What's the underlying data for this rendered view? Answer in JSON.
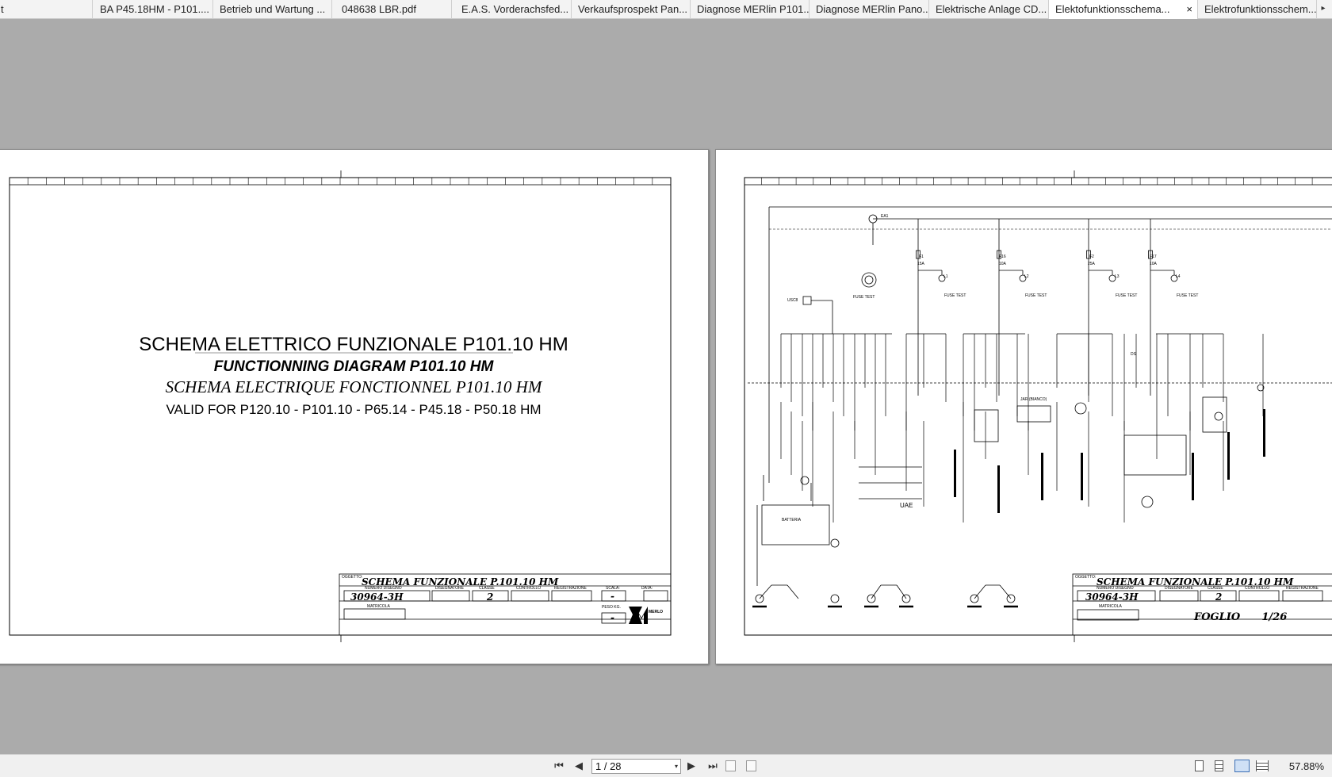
{
  "tabs": [
    {
      "label": "t"
    },
    {
      "label": "BA P45.18HM - P101...."
    },
    {
      "label": "Betrieb und Wartung ..."
    },
    {
      "label": "048638 LBR.pdf"
    },
    {
      "label": "E.A.S. Vorderachsfed..."
    },
    {
      "label": "Verkaufsprospekt Pan..."
    },
    {
      "label": "Diagnose MERlin P101..."
    },
    {
      "label": "Diagnose MERlin Pano..."
    },
    {
      "label": "Elektrische Anlage CD..."
    },
    {
      "label": "Elektofunktionsschema..."
    },
    {
      "label": "Elektrofunktionsschem..."
    }
  ],
  "tab_close": "×",
  "tab_scroll": "▸",
  "page1": {
    "title_it": "SCHEMA ELETTRICO FUNZIONALE P101.10 HM",
    "title_en": "FUNCTIONNING DIAGRAM P101.10 HM",
    "title_fr": "SCHEMA ELECTRIQUE FONCTIONNEL  P101.10 HM",
    "valid": "VALID FOR P120.10 - P101.10 - P65.14 - P45.18 - P50.18 HM",
    "tb": {
      "oggetto_label": "OGGETTO:",
      "oggetto": "SCHEMA  FUNZIONALE  P.101.10  HM",
      "numero_label": "NUMERO DISEGNO",
      "numero": "30964-3H",
      "disegnatore_label": "DISEGNATORE",
      "classe_label": "CLASSE",
      "classe": "2",
      "controllo_label": "CONTROLLO",
      "registrazione_label": "REGISTRAZIONE",
      "scala_label": "SCALA:",
      "scala": "-",
      "data_label": "DATA:",
      "matricola_label": "MATRICOLA",
      "peso_label": "PESO KG.",
      "peso": "-",
      "logo": "MERLO"
    }
  },
  "page2": {
    "labels": {
      "ea1": "EA1",
      "fuse_test_main": "FUSE TEST",
      "usc8": "USC8",
      "f1": "F1",
      "f1a": "15A",
      "f16": "F16",
      "f16a": "10A",
      "f2": "F2",
      "f2a": "25A",
      "f17": "F17",
      "f17a": "10A",
      "l1": "L1",
      "l2": "L2",
      "l3": "L3",
      "l4": "L4",
      "ft": "FUSE TEST",
      "ds": "DS",
      "d": "D",
      "uae": "UAE",
      "batteria": "BATTERIA",
      "jar": "JAR (BIANCO)"
    },
    "tb": {
      "oggetto_label": "OGGETTO:",
      "oggetto": "SCHEMA  FUNZIONALE  P.101.10  HM",
      "numero_label": "NUMERO DISEGNO",
      "numero": "30964-3H",
      "disegnatore_label": "DISEGNATORE",
      "classe_label": "CLASSE",
      "classe": "2",
      "controllo_label": "CONTROLLO",
      "registrazione_label": "REGISTRAZIONE",
      "matricola_label": "MATRICOLA",
      "foglio": "FOGLIO      1/26"
    }
  },
  "bottom": {
    "first": "⏮",
    "prev": "◀",
    "page_value": "1 / 28",
    "page_dropdown": "▾",
    "next": "▶",
    "last": "⏭",
    "zoom": "57.88%"
  }
}
